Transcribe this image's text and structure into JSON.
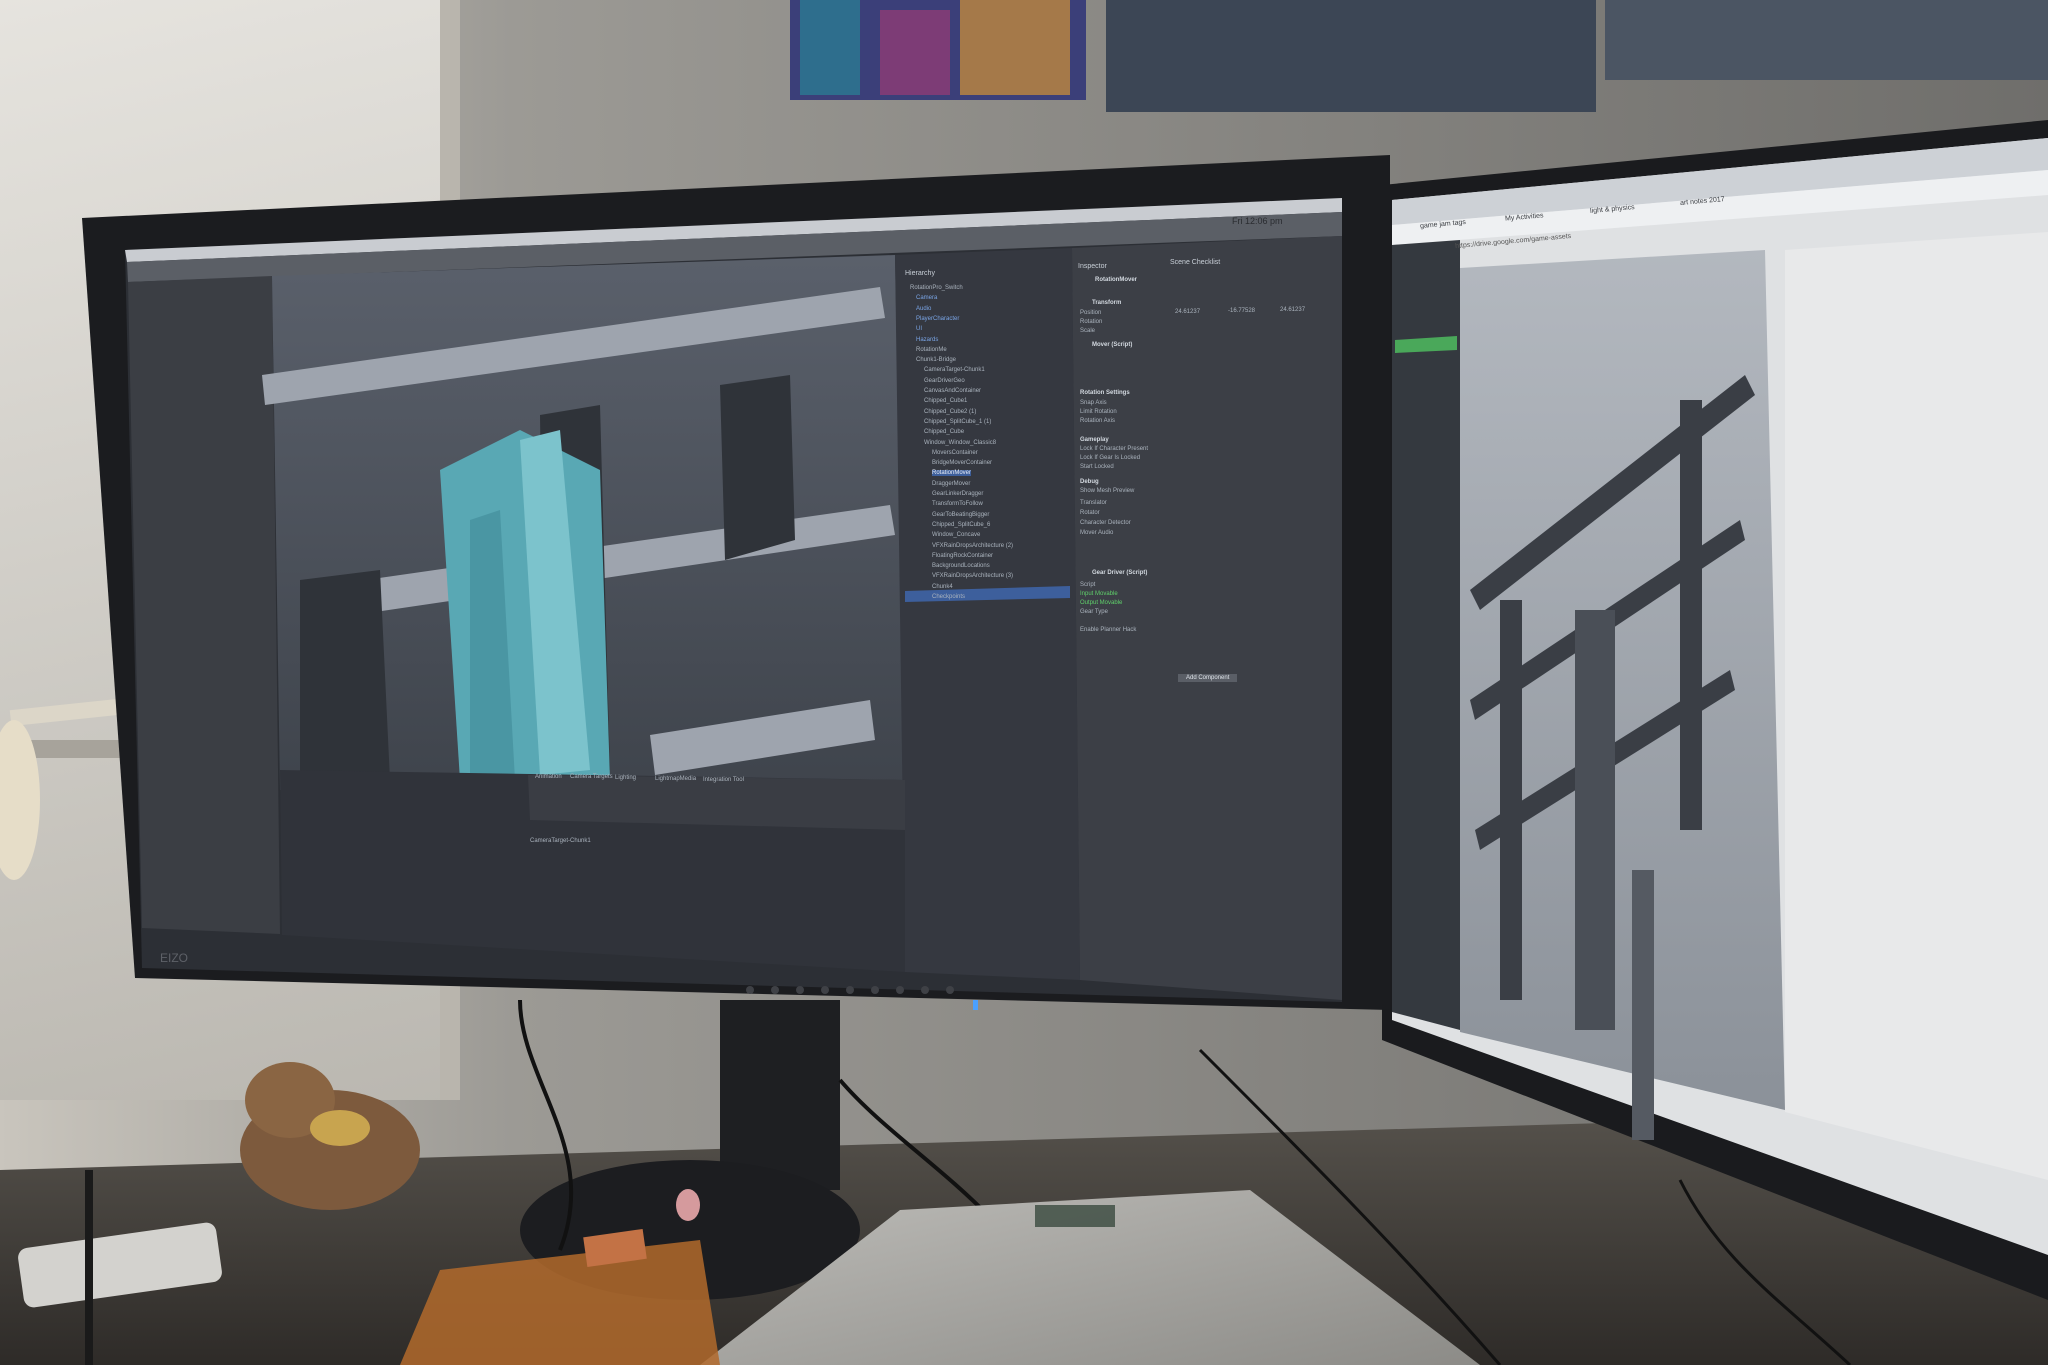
{
  "unity": {
    "clock": "Fri 12:06 pm",
    "panels": {
      "hierarchy_title": "Hierarchy",
      "inspector_title": "Inspector",
      "scene_checklist": "Scene Checklist"
    },
    "hierarchy_items": [
      {
        "label": "RotationPro_Switch",
        "style": "head"
      },
      {
        "label": "Camera",
        "style": "blue"
      },
      {
        "label": "Audio",
        "style": "blue"
      },
      {
        "label": "PlayerCharacter",
        "style": "blue"
      },
      {
        "label": "UI",
        "style": "blue"
      },
      {
        "label": "Hazards",
        "style": "blue"
      },
      {
        "label": "RotationMe",
        "style": "normal"
      },
      {
        "label": "Chunk1-Bridge",
        "style": "normal"
      },
      {
        "label": "CameraTarget-Chunk1",
        "style": "normal"
      },
      {
        "label": "GearDriverGeo",
        "style": "normal"
      },
      {
        "label": "CanvasAndContainer",
        "style": "normal"
      },
      {
        "label": "Chipped_Cube1",
        "style": "normal"
      },
      {
        "label": "Chipped_Cube2 (1)",
        "style": "normal"
      },
      {
        "label": "Chipped_SplitCube_1 (1)",
        "style": "normal"
      },
      {
        "label": "Chipped_Cube",
        "style": "normal"
      },
      {
        "label": "Window_Window_Classic8",
        "style": "normal"
      },
      {
        "label": "MoversContainer",
        "style": "normal"
      },
      {
        "label": "BridgeMoverContainer",
        "style": "normal"
      },
      {
        "label": "RotationMover",
        "style": "selected"
      },
      {
        "label": "DraggerMover",
        "style": "normal"
      },
      {
        "label": "GearLinkerDragger",
        "style": "normal"
      },
      {
        "label": "TransformToFollow",
        "style": "normal"
      },
      {
        "label": "GearToBeatingBigger",
        "style": "normal"
      },
      {
        "label": "Chipped_SplitCube_6",
        "style": "normal"
      },
      {
        "label": "Window_Concave",
        "style": "normal"
      },
      {
        "label": "VFXRainDropsArchitecture (2)",
        "style": "normal"
      },
      {
        "label": "FloatingRockContainer",
        "style": "normal"
      },
      {
        "label": "BackgroundLocations",
        "style": "normal"
      },
      {
        "label": "VFXRainDropsArchitecture (3)",
        "style": "normal"
      },
      {
        "label": "Chunk4",
        "style": "normal"
      },
      {
        "label": "Checkpoints",
        "style": "normal"
      }
    ],
    "inspector": {
      "object_name": "RotationMover",
      "transform_label": "Transform",
      "position_label": "Position",
      "rotation_label": "Rotation",
      "scale_label": "Scale",
      "position_values": [
        "24.61237",
        "-16.77528",
        "24.61237"
      ],
      "mover_script": "Mover (Script)",
      "rotation_settings": "Rotation Settings",
      "snap_axis": "Snap Axis",
      "limit_rotation": "Limit Rotation",
      "rotation_axis": "Rotation Axis",
      "gameplay": "Gameplay",
      "lock_if_character": "Lock If Character Present",
      "lock_if_gear": "Lock If Gear Is Locked",
      "start_locked": "Start Locked",
      "debug": "Debug",
      "show_mesh_preview": "Show Mesh Preview",
      "translator": "Translator",
      "rotator": "Rotator",
      "character_detector": "Character Detector",
      "mover_audio": "Mover Audio",
      "gear_driver": "Gear Driver (Script)",
      "script_label": "Script",
      "input_movable": "Input Movable",
      "output_movable": "Output Movable",
      "gear_type": "Gear Type",
      "enable_planner": "Enable Planner Hack",
      "add_component": "Add Component"
    },
    "bottom_tabs": [
      "Animation",
      "Camera Targets",
      "Lighting",
      "LightmapMedia",
      "Integration Tool"
    ],
    "camera_target_label": "CameraTarget-Chunk1"
  },
  "browser": {
    "tabs": [
      "game jam tags",
      "My Activities",
      "light & physics",
      "art notes 2017"
    ],
    "url": "https://drive.google.com/game-assets"
  },
  "colors": {
    "wall": "#8d8b86",
    "monitor_bezel": "#1b1c1f",
    "unity_bg": "#3a3d44",
    "viewport_bg": "#4e555f",
    "teal_geometry": "#59a8b4",
    "selection_blue": "#3d5f9c"
  }
}
